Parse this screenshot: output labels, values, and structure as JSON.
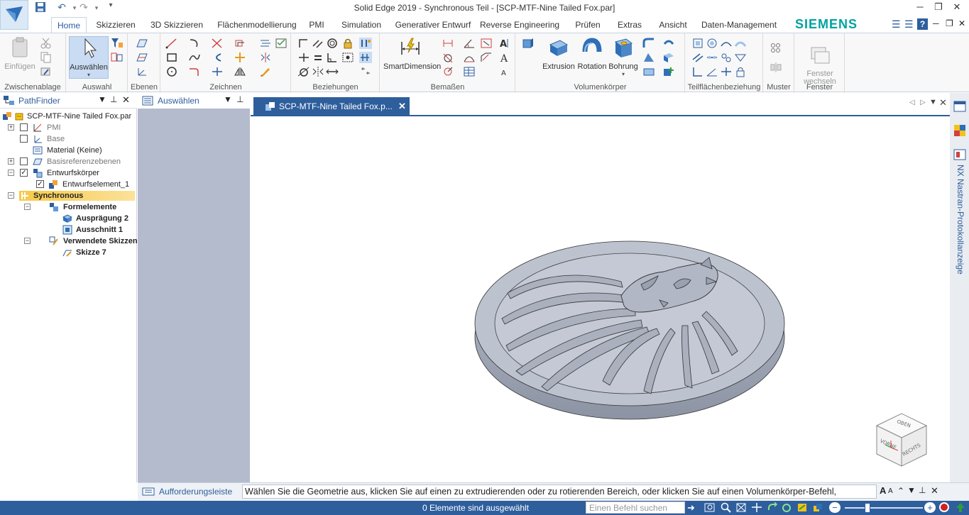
{
  "title": "Solid Edge 2019 - Synchronous Teil - [SCP-MTF-Nine Tailed Fox.par]",
  "ribbon_tabs": [
    "Home",
    "Skizzieren",
    "3D Skizzieren",
    "Flächenmodellierung",
    "PMI",
    "Simulation",
    "Generativer Entwurf",
    "Reverse Engineering",
    "Prüfen",
    "Extras",
    "Ansicht",
    "Daten-Management"
  ],
  "brand": "SIEMENS",
  "ribbon": {
    "einfuegen": "Einfügen",
    "auswaehlen": "Auswählen",
    "smartdimension": "SmartDimension",
    "extrusion": "Extrusion",
    "rotation": "Rotation",
    "bohrung": "Bohrung",
    "fenster_wechseln": "Fenster\nwechseln",
    "groups": {
      "zwischenablage": "Zwischenablage",
      "auswahl": "Auswahl",
      "ebenen": "Ebenen",
      "zeichnen": "Zeichnen",
      "beziehungen": "Beziehungen",
      "bemassen": "Bemaßen",
      "volumenkoerper": "Volumenkörper",
      "teilflaechenbeziehung": "Teilflächenbeziehung",
      "muster": "Muster",
      "fenster": "Fenster"
    }
  },
  "pathfinder": {
    "title": "PathFinder",
    "items": [
      {
        "label": "SCP-MTF-Nine Tailed Fox.par"
      },
      {
        "label": "PMI"
      },
      {
        "label": "Base"
      },
      {
        "label": "Material (Keine)"
      },
      {
        "label": "Basisreferenzebenen"
      },
      {
        "label": "Entwurfskörper"
      },
      {
        "label": "Entwurfselement_1"
      },
      {
        "label": "Synchronous"
      },
      {
        "label": "Formelemente"
      },
      {
        "label": "Ausprägung 2"
      },
      {
        "label": "Ausschnitt 1"
      },
      {
        "label": "Verwendete Skizzen"
      },
      {
        "label": "Skizze 7"
      }
    ]
  },
  "select_panel": {
    "title": "Auswählen"
  },
  "document_tab": "SCP-MTF-Nine Tailed Fox.p...",
  "side_panel": "NX Nastran-Protokollanzeige",
  "viewcube": {
    "top": "OBEN",
    "front": "VORNE",
    "right": "RECHTS"
  },
  "prompt": {
    "label": "Aufforderungsleiste",
    "text": "Wählen Sie die Geometrie aus, klicken Sie auf einen zu extrudierenden oder zu rotierenden Bereich, oder klicken Sie auf einen Volumenkörper-Befehl,"
  },
  "status": {
    "text": "0 Elemente sind ausgewählt",
    "command_placeholder": "Einen Befehl suchen"
  },
  "colors": {
    "accent": "#2e5e9c",
    "brand": "#00a2a0",
    "highlight": "#f7c948",
    "panel": "#b4bbcd"
  }
}
